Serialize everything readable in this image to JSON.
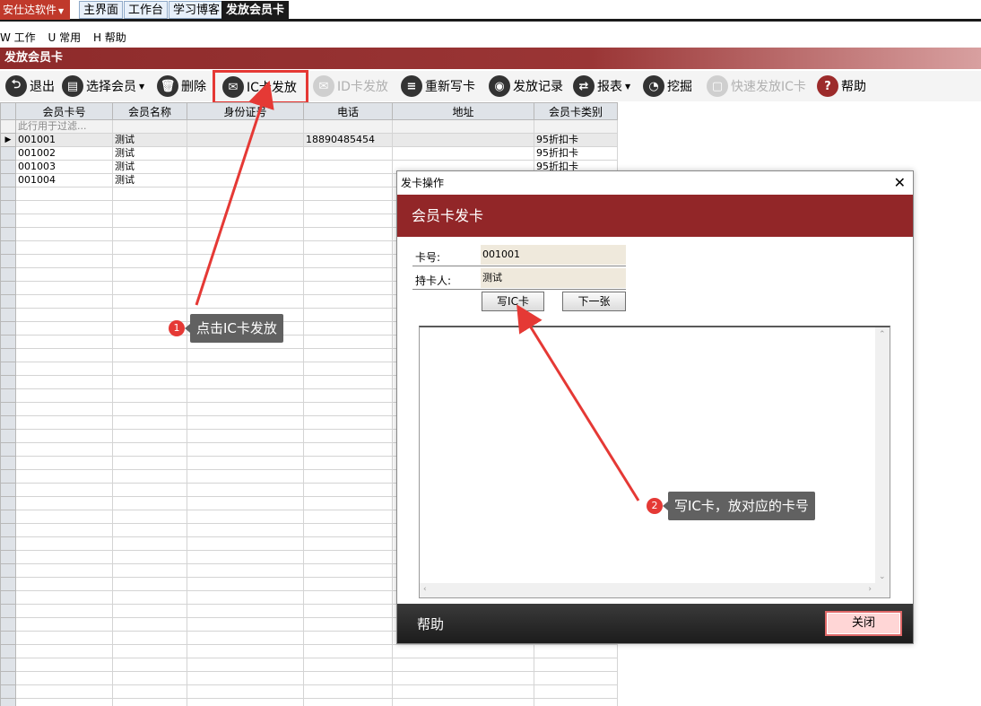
{
  "topbar": {
    "app_menu": "安仕达软件",
    "tabs": [
      "主界面",
      "工作台",
      "学习博客",
      "发放会员卡"
    ]
  },
  "menubar": {
    "items": [
      "W 工作",
      "U 常用",
      "H 帮助"
    ]
  },
  "window_title": "发放会员卡",
  "toolbar": {
    "exit": "退出",
    "select_member": "选择会员",
    "delete": "删除",
    "ic_issue": "IC卡发放",
    "id_issue": "ID卡发放",
    "rewrite": "重新写卡",
    "issue_log": "发放记录",
    "report": "报表",
    "mine": "挖掘",
    "quick_ic": "快速发放IC卡",
    "help": "帮助"
  },
  "grid": {
    "columns": [
      "会员卡号",
      "会员名称",
      "身份证号",
      "电话",
      "地址",
      "会员卡类别"
    ],
    "filter_placeholder": "此行用于过滤...",
    "rows": [
      [
        "001001",
        "测试",
        "",
        "18890485454",
        "",
        "95折扣卡"
      ],
      [
        "001002",
        "测试",
        "",
        "",
        "",
        "95折扣卡"
      ],
      [
        "001003",
        "测试",
        "",
        "",
        "",
        "95折扣卡"
      ],
      [
        "001004",
        "测试",
        "",
        "",
        "",
        ""
      ]
    ]
  },
  "dialog": {
    "title": "发卡操作",
    "band_title": "会员卡发卡",
    "card_no_label": "卡号:",
    "card_no_value": "001001",
    "holder_label": "持卡人:",
    "holder_value": "测试",
    "write_button": "写IC卡",
    "next_button": "下一张",
    "help": "帮助",
    "close_button": "关闭"
  },
  "annotations": [
    {
      "num": "1",
      "text": "点击IC卡发放"
    },
    {
      "num": "2",
      "text": "写IC卡，放对应的卡号"
    }
  ],
  "colors": {
    "brand_red": "#922628",
    "annotation_red": "#e53935",
    "annotation_box": "#616161"
  }
}
